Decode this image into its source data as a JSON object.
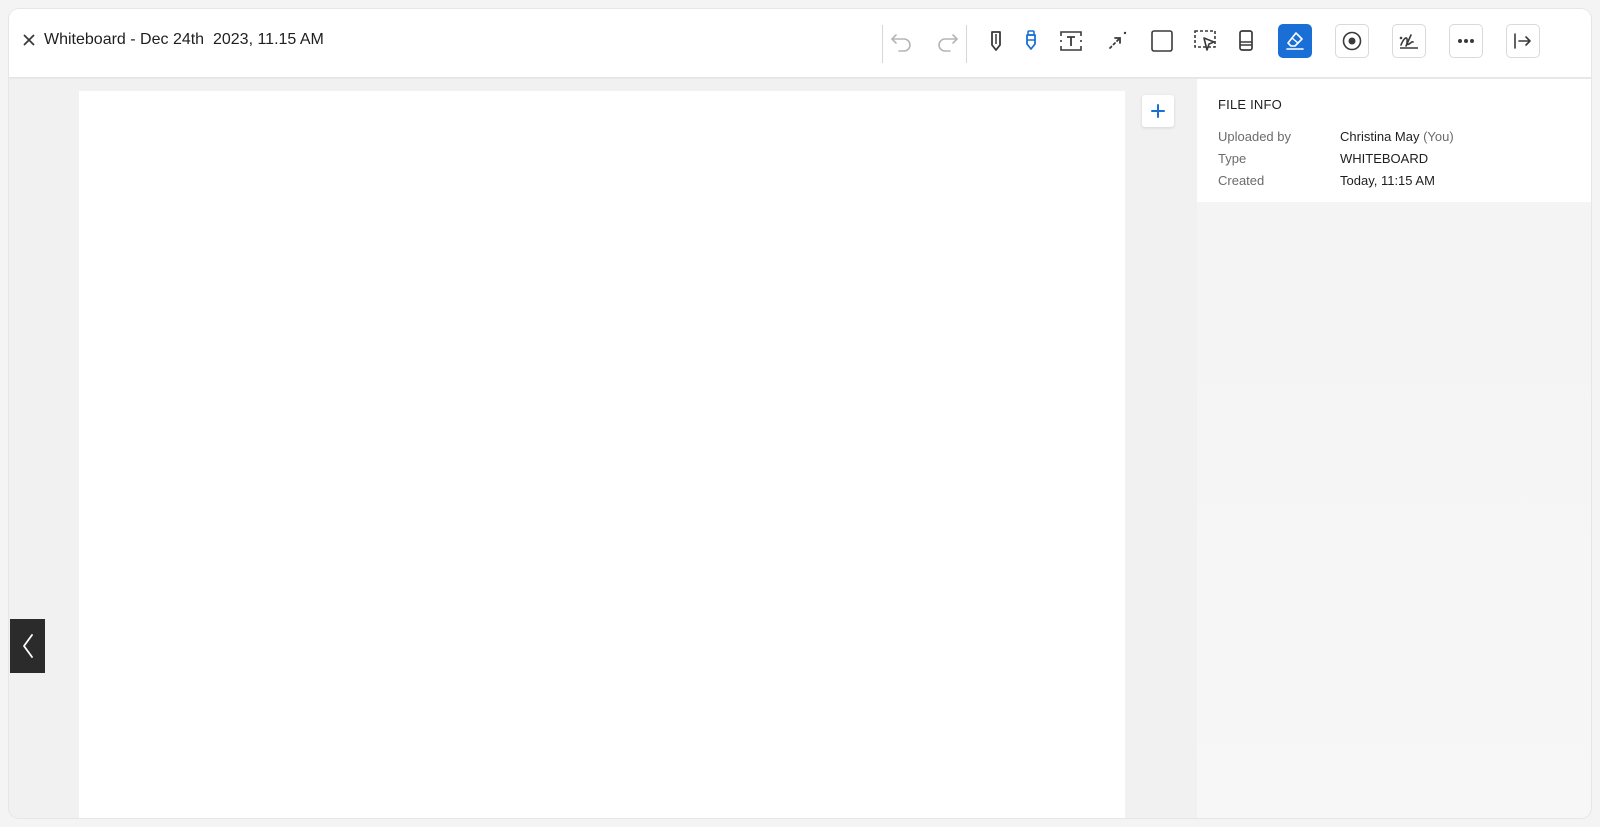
{
  "window": {
    "title": "Whiteboard - Dec 24th  2023, 11.15 AM"
  },
  "toolbar": {
    "tools": [
      {
        "name": "undo",
        "icon": "undo-icon"
      },
      {
        "name": "redo",
        "icon": "redo-icon"
      },
      {
        "name": "pencil",
        "icon": "pencil-icon"
      },
      {
        "name": "marker",
        "icon": "marker-icon"
      },
      {
        "name": "text",
        "icon": "text-box-icon"
      },
      {
        "name": "laser-pointer",
        "icon": "laser-pointer-icon"
      },
      {
        "name": "rectangle",
        "icon": "rectangle-icon"
      },
      {
        "name": "select",
        "icon": "select-icon"
      },
      {
        "name": "eraser",
        "icon": "eraser-icon"
      },
      {
        "name": "clear",
        "icon": "clear-icon"
      },
      {
        "name": "record",
        "icon": "record-icon"
      },
      {
        "name": "sign",
        "icon": "signature-icon"
      },
      {
        "name": "more",
        "icon": "more-icon"
      },
      {
        "name": "collapse-panel",
        "icon": "collapse-panel-icon"
      }
    ],
    "active_tool": "clear"
  },
  "file_info": {
    "heading": "FILE INFO",
    "uploaded_by_label": "Uploaded by",
    "uploaded_by_value": "Christina May",
    "uploaded_by_suffix": "(You)",
    "type_label": "Type",
    "type_value": "WHITEBOARD",
    "created_label": "Created",
    "created_value": "Today, 11:15 AM"
  },
  "colors": {
    "accent": "#1a6fd6",
    "prev_button": "#2b2b2b",
    "canvas": "#ffffff",
    "background": "#f1f1f1"
  }
}
